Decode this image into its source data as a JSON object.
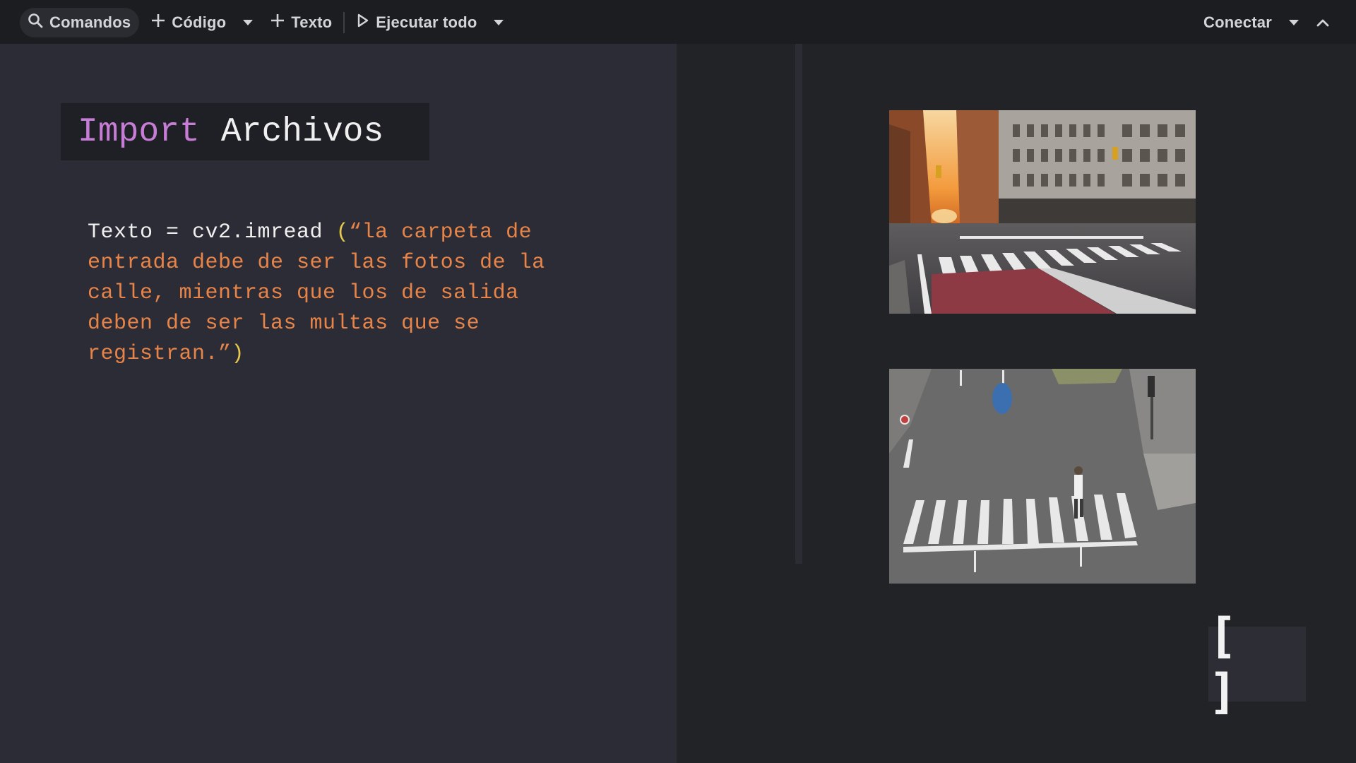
{
  "toolbar": {
    "commands_label": "Comandos",
    "code_label": "Código",
    "text_label": "Texto",
    "run_all_label": "Ejecutar todo",
    "connect_label": "Conectar"
  },
  "heading": {
    "keyword": "Import",
    "word": "Archivos"
  },
  "code_cell": {
    "prefix": "Texto = cv2.imread ",
    "open_paren": "(",
    "string": "“la carpeta de entrada debe de ser las fotos de la calle, mientras que los de salida deben de ser las multas que se registran.”",
    "close_paren": ")"
  },
  "bracket_button": {
    "label": "[ ]"
  },
  "colors": {
    "keyword": "#c77dd6",
    "string": "#e88448",
    "paren": "#e6c94c",
    "toolbar_bg": "#1c1d20",
    "panel_bg": "#2b2c35"
  },
  "icons": [
    "search-icon",
    "plus-icon",
    "play-icon",
    "chevron-down-icon",
    "chevron-up-icon"
  ]
}
